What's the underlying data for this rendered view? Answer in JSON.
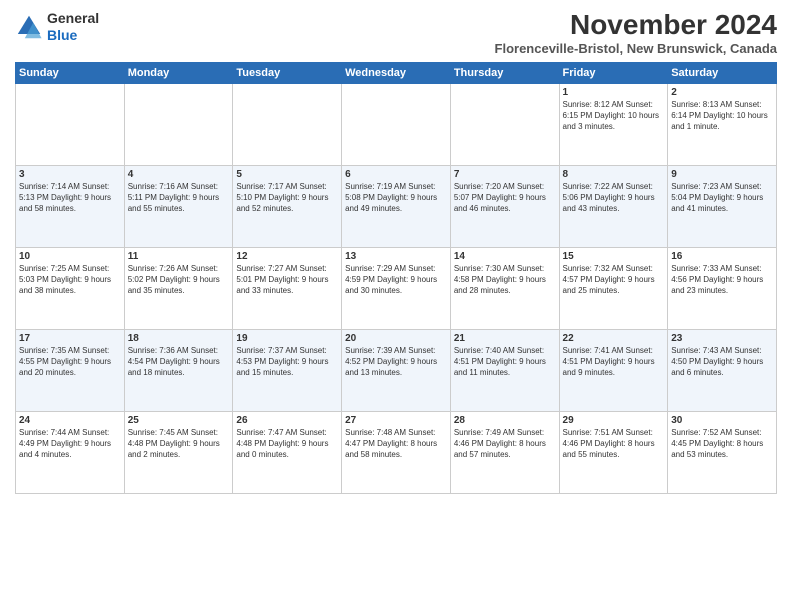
{
  "logo": {
    "general": "General",
    "blue": "Blue"
  },
  "title": "November 2024",
  "location": "Florenceville-Bristol, New Brunswick, Canada",
  "weekdays": [
    "Sunday",
    "Monday",
    "Tuesday",
    "Wednesday",
    "Thursday",
    "Friday",
    "Saturday"
  ],
  "weeks": [
    [
      {
        "day": "",
        "info": ""
      },
      {
        "day": "",
        "info": ""
      },
      {
        "day": "",
        "info": ""
      },
      {
        "day": "",
        "info": ""
      },
      {
        "day": "",
        "info": ""
      },
      {
        "day": "1",
        "info": "Sunrise: 8:12 AM\nSunset: 6:15 PM\nDaylight: 10 hours and 3 minutes."
      },
      {
        "day": "2",
        "info": "Sunrise: 8:13 AM\nSunset: 6:14 PM\nDaylight: 10 hours and 1 minute."
      }
    ],
    [
      {
        "day": "3",
        "info": "Sunrise: 7:14 AM\nSunset: 5:13 PM\nDaylight: 9 hours and 58 minutes."
      },
      {
        "day": "4",
        "info": "Sunrise: 7:16 AM\nSunset: 5:11 PM\nDaylight: 9 hours and 55 minutes."
      },
      {
        "day": "5",
        "info": "Sunrise: 7:17 AM\nSunset: 5:10 PM\nDaylight: 9 hours and 52 minutes."
      },
      {
        "day": "6",
        "info": "Sunrise: 7:19 AM\nSunset: 5:08 PM\nDaylight: 9 hours and 49 minutes."
      },
      {
        "day": "7",
        "info": "Sunrise: 7:20 AM\nSunset: 5:07 PM\nDaylight: 9 hours and 46 minutes."
      },
      {
        "day": "8",
        "info": "Sunrise: 7:22 AM\nSunset: 5:06 PM\nDaylight: 9 hours and 43 minutes."
      },
      {
        "day": "9",
        "info": "Sunrise: 7:23 AM\nSunset: 5:04 PM\nDaylight: 9 hours and 41 minutes."
      }
    ],
    [
      {
        "day": "10",
        "info": "Sunrise: 7:25 AM\nSunset: 5:03 PM\nDaylight: 9 hours and 38 minutes."
      },
      {
        "day": "11",
        "info": "Sunrise: 7:26 AM\nSunset: 5:02 PM\nDaylight: 9 hours and 35 minutes."
      },
      {
        "day": "12",
        "info": "Sunrise: 7:27 AM\nSunset: 5:01 PM\nDaylight: 9 hours and 33 minutes."
      },
      {
        "day": "13",
        "info": "Sunrise: 7:29 AM\nSunset: 4:59 PM\nDaylight: 9 hours and 30 minutes."
      },
      {
        "day": "14",
        "info": "Sunrise: 7:30 AM\nSunset: 4:58 PM\nDaylight: 9 hours and 28 minutes."
      },
      {
        "day": "15",
        "info": "Sunrise: 7:32 AM\nSunset: 4:57 PM\nDaylight: 9 hours and 25 minutes."
      },
      {
        "day": "16",
        "info": "Sunrise: 7:33 AM\nSunset: 4:56 PM\nDaylight: 9 hours and 23 minutes."
      }
    ],
    [
      {
        "day": "17",
        "info": "Sunrise: 7:35 AM\nSunset: 4:55 PM\nDaylight: 9 hours and 20 minutes."
      },
      {
        "day": "18",
        "info": "Sunrise: 7:36 AM\nSunset: 4:54 PM\nDaylight: 9 hours and 18 minutes."
      },
      {
        "day": "19",
        "info": "Sunrise: 7:37 AM\nSunset: 4:53 PM\nDaylight: 9 hours and 15 minutes."
      },
      {
        "day": "20",
        "info": "Sunrise: 7:39 AM\nSunset: 4:52 PM\nDaylight: 9 hours and 13 minutes."
      },
      {
        "day": "21",
        "info": "Sunrise: 7:40 AM\nSunset: 4:51 PM\nDaylight: 9 hours and 11 minutes."
      },
      {
        "day": "22",
        "info": "Sunrise: 7:41 AM\nSunset: 4:51 PM\nDaylight: 9 hours and 9 minutes."
      },
      {
        "day": "23",
        "info": "Sunrise: 7:43 AM\nSunset: 4:50 PM\nDaylight: 9 hours and 6 minutes."
      }
    ],
    [
      {
        "day": "24",
        "info": "Sunrise: 7:44 AM\nSunset: 4:49 PM\nDaylight: 9 hours and 4 minutes."
      },
      {
        "day": "25",
        "info": "Sunrise: 7:45 AM\nSunset: 4:48 PM\nDaylight: 9 hours and 2 minutes."
      },
      {
        "day": "26",
        "info": "Sunrise: 7:47 AM\nSunset: 4:48 PM\nDaylight: 9 hours and 0 minutes."
      },
      {
        "day": "27",
        "info": "Sunrise: 7:48 AM\nSunset: 4:47 PM\nDaylight: 8 hours and 58 minutes."
      },
      {
        "day": "28",
        "info": "Sunrise: 7:49 AM\nSunset: 4:46 PM\nDaylight: 8 hours and 57 minutes."
      },
      {
        "day": "29",
        "info": "Sunrise: 7:51 AM\nSunset: 4:46 PM\nDaylight: 8 hours and 55 minutes."
      },
      {
        "day": "30",
        "info": "Sunrise: 7:52 AM\nSunset: 4:45 PM\nDaylight: 8 hours and 53 minutes."
      }
    ]
  ]
}
